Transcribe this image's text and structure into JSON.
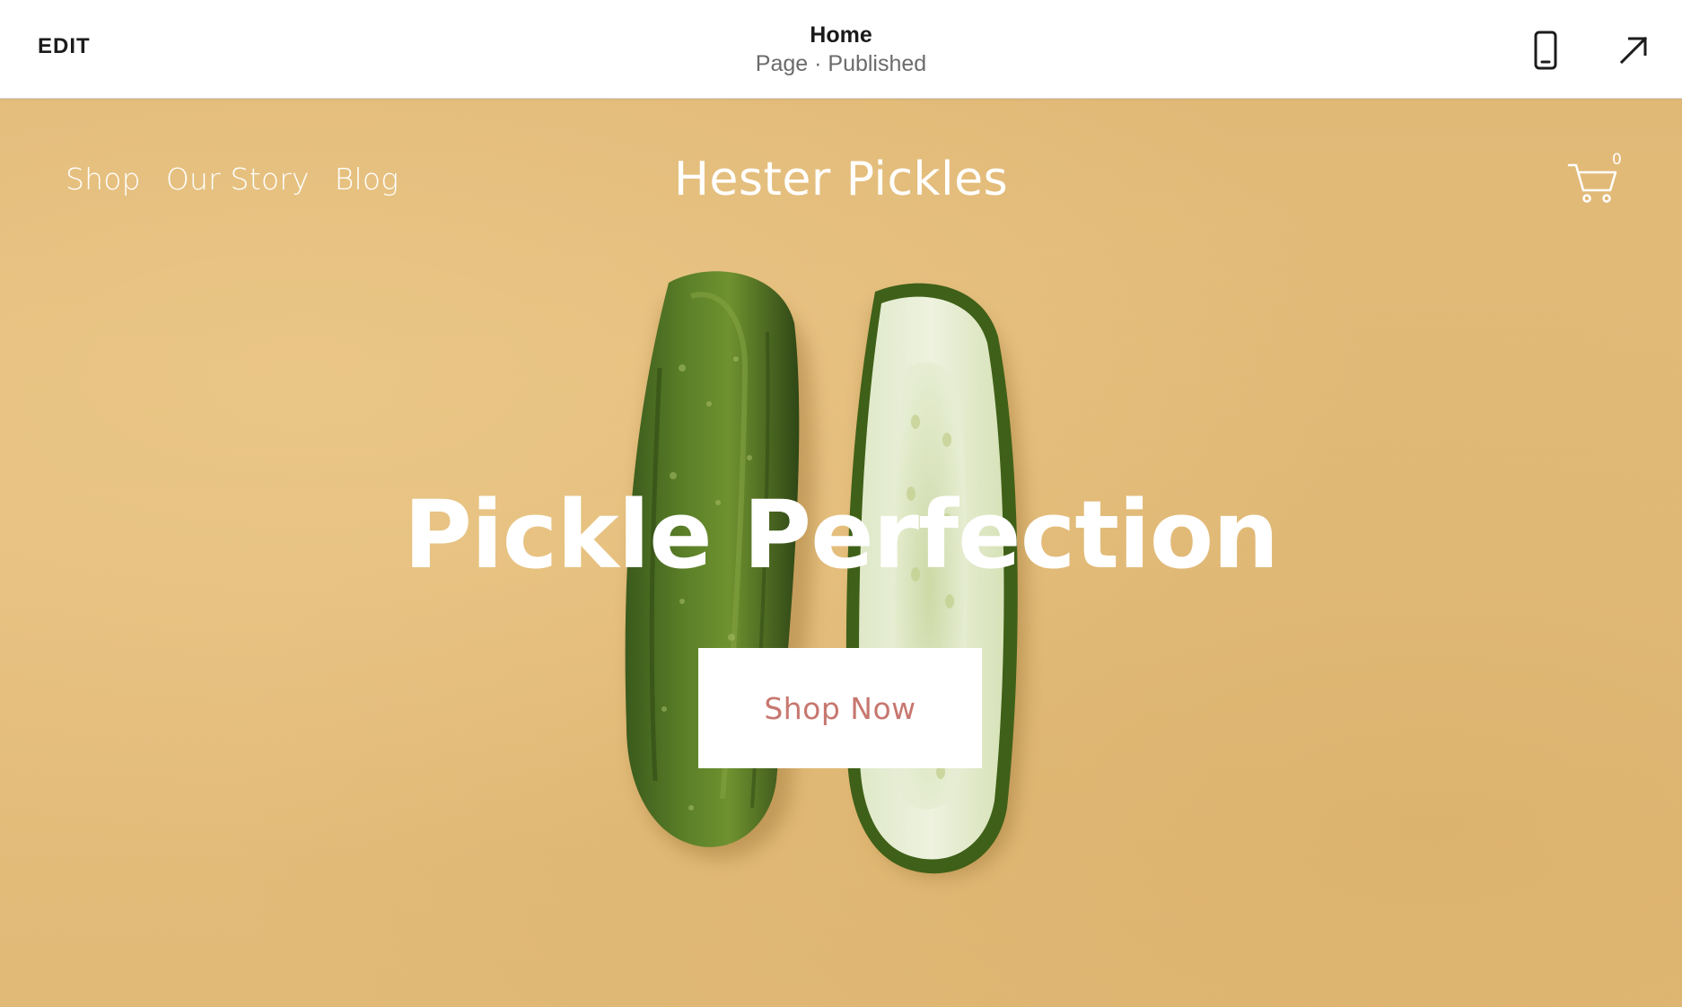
{
  "editor": {
    "edit_label": "EDIT",
    "page_title": "Home",
    "page_status": "Page · Published",
    "mobile_icon": "mobile-phone-icon",
    "external_icon": "arrow-up-right-icon"
  },
  "site": {
    "nav": [
      "Shop",
      "Our Story",
      "Blog"
    ],
    "title": "Hester Pickles",
    "cart_icon": "shopping-cart-icon",
    "cart_count": "0",
    "hero_heading": "Pickle Perfection",
    "cta_label": "Shop Now",
    "hero_image": "two-pickles-whole-and-halved-photo"
  },
  "colors": {
    "background": "#e3bb78",
    "cta_text": "#c7776f",
    "nav_text": "#ffffff"
  }
}
